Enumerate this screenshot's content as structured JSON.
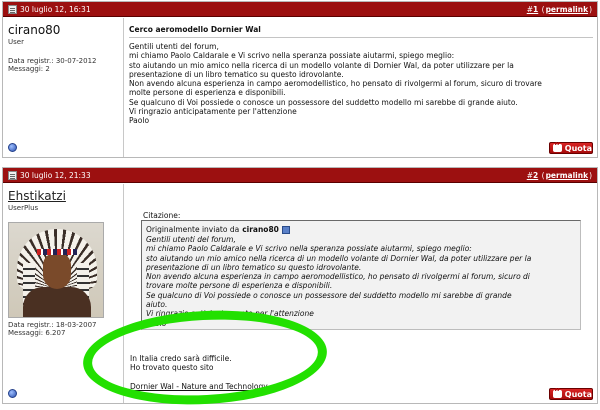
{
  "posts": [
    {
      "date": "30 luglio 12, 16:31",
      "post_number_prefix": "#",
      "post_number": "1",
      "permalink": "permalink",
      "username": "cirano80",
      "usertitle": "User",
      "info": {
        "registered_label": "Data registr.:",
        "registered": "30-07-2012",
        "messages_label": "Messaggi:",
        "messages": "2"
      },
      "title": "Cerco aeromodello Dornier Wal",
      "body": "Gentili utenti del forum,\nmi chiamo Paolo Caldarale e Vi scrivo nella speranza possiate aiutarmi, spiego meglio:\nsto aiutando un mio amico nella ricerca di un modello volante di Dornier Wal, da poter utilizzare per la\npresentazione di un libro tematico su questo idrovolante.\nNon avendo alcuna esperienza in campo aeromodellistico, ho pensato di rivolgermi al forum, sicuro di trovare\nmolte persone di esperienza e disponibili.\nSe qualcuno di Voi possiede o conosce un possessore del suddetto modello mi sarebbe di grande aiuto.\nVi ringrazio anticipatamente per l'attenzione\nPaolo",
      "quote_button": "Quota"
    },
    {
      "date": "30 luglio 12, 21:33",
      "post_number_prefix": "#",
      "post_number": "2",
      "permalink": "permalink",
      "username": "Ehstikatzi",
      "usertitle": "UserPlus",
      "info": {
        "registered_label": "Data registr.:",
        "registered": "18-03-2007",
        "messages_label": "Messaggi:",
        "messages": "6.207"
      },
      "quote_label": "Citazione:",
      "quote_origin": "Originalmente inviato da",
      "quote_author": "cirano80",
      "quote_text": "Gentili utenti del forum,\nmi chiamo Paolo Caldarale e Vi scrivo nella speranza possiate aiutarmi, spiego meglio:\nsto aiutando un mio amico nella ricerca di un modello volante di Dornier Wal, da poter utilizzare per la\npresentazione di un libro tematico su questo idrovolante.\nNon avendo alcuna esperienza in campo aeromodellistico, ho pensato di rivolgermi al forum, sicuro di\ntrovare molte persone di esperienza e disponibili.\nSe qualcuno di Voi possiede o conosce un possessore del suddetto modello mi sarebbe di grande\naiuto.\nVi ringrazio anticipatamente per l'attenzione\nPaolo",
      "reply_line1": "In Italia credo sarà difficile.",
      "reply_line2": "Ho trovato questo sito",
      "reply_link": "Dornier Wal - Nature and Technology",
      "quote_button": "Quota"
    }
  ],
  "colors": {
    "header_bar": "#9c1010",
    "quote_button": "#c21a1a",
    "highlight_scribble": "#22e000"
  }
}
